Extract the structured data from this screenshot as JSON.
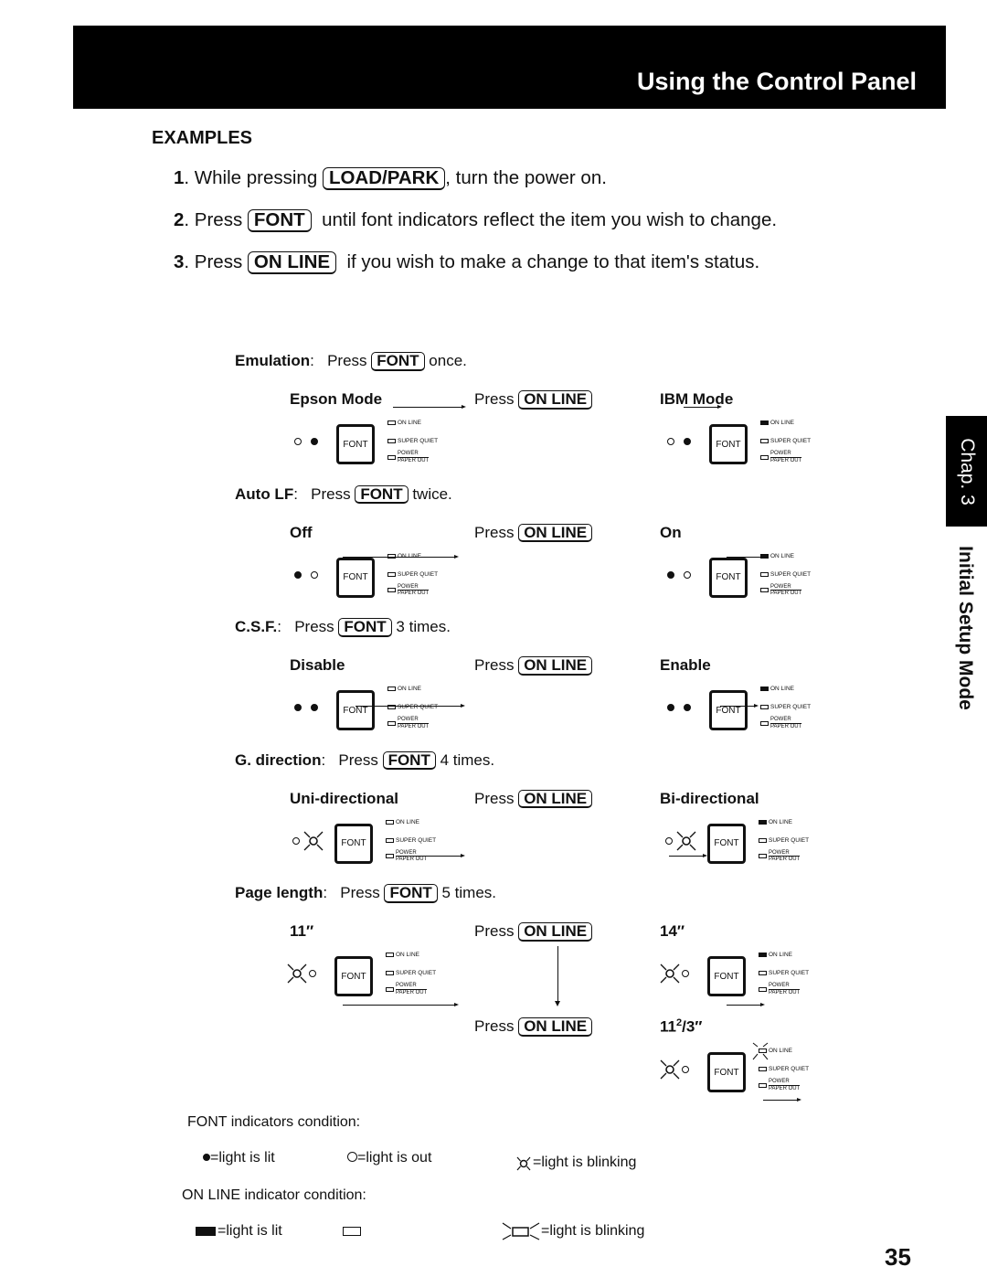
{
  "header": {
    "title": "Using the Control Panel"
  },
  "side_tab": {
    "chapter": "Chap. 3",
    "section": "Initial Setup Mode"
  },
  "examples": {
    "heading": "EXAMPLES",
    "steps": [
      {
        "num": "1",
        "pre": ". While pressing ",
        "key": "LOAD/PARK",
        "post": ", turn the power on."
      },
      {
        "num": "2",
        "pre": ". Press ",
        "key": "FONT",
        "post": "  until font indicators reflect the item you wish to change."
      },
      {
        "num": "3",
        "pre": ". Press ",
        "key": "ON LINE",
        "post": "  if you wish to make a change to that item's status."
      }
    ]
  },
  "common": {
    "press": "Press",
    "font_key": "FONT",
    "online_key": "ON LINE",
    "font_btn": "FONT",
    "ind_online": "ON LINE",
    "ind_quiet": "SUPER QUIET",
    "ind_power": "POWER",
    "ind_paper": "PAPER OUT"
  },
  "settings": [
    {
      "name": "Emulation",
      "times": "once.",
      "from": "Epson Mode",
      "to": "IBM Mode",
      "font_lights": [
        "out",
        "lit"
      ],
      "from_online": "out",
      "to_online": "lit"
    },
    {
      "name": "Auto LF",
      "times": "twice.",
      "from": "Off",
      "to": "On",
      "font_lights": [
        "lit",
        "out"
      ],
      "from_online": "out",
      "to_online": "lit"
    },
    {
      "name": "C.S.F.",
      "times": "3 times.",
      "from": "Disable",
      "to": "Enable",
      "font_lights": [
        "lit",
        "lit"
      ],
      "from_online": "out",
      "to_online": "lit"
    },
    {
      "name": "G. direction",
      "times": "4 times.",
      "from": "Uni-directional",
      "to": "Bi-directional",
      "font_lights": [
        "out",
        "blinking"
      ],
      "from_online": "out",
      "to_online": "lit"
    },
    {
      "name": "Page length",
      "times": "5 times.",
      "from": "11″",
      "to": "14″",
      "font_lights": [
        "blinking",
        "out"
      ],
      "from_online": "out",
      "to_online": "lit",
      "extra_to": {
        "whole": "11",
        "sup": "2",
        "rest": "/3″",
        "online": "blinking"
      }
    }
  ],
  "legend": {
    "font_heading": "FONT indicators condition:",
    "font_lit": "=light is lit",
    "font_out": "=light is out",
    "font_blink": "=light is blinking",
    "online_heading": "ON LINE indicator condition:",
    "online_lit": "=light is lit",
    "online_blink": "=light is blinking"
  },
  "page_number": "35"
}
